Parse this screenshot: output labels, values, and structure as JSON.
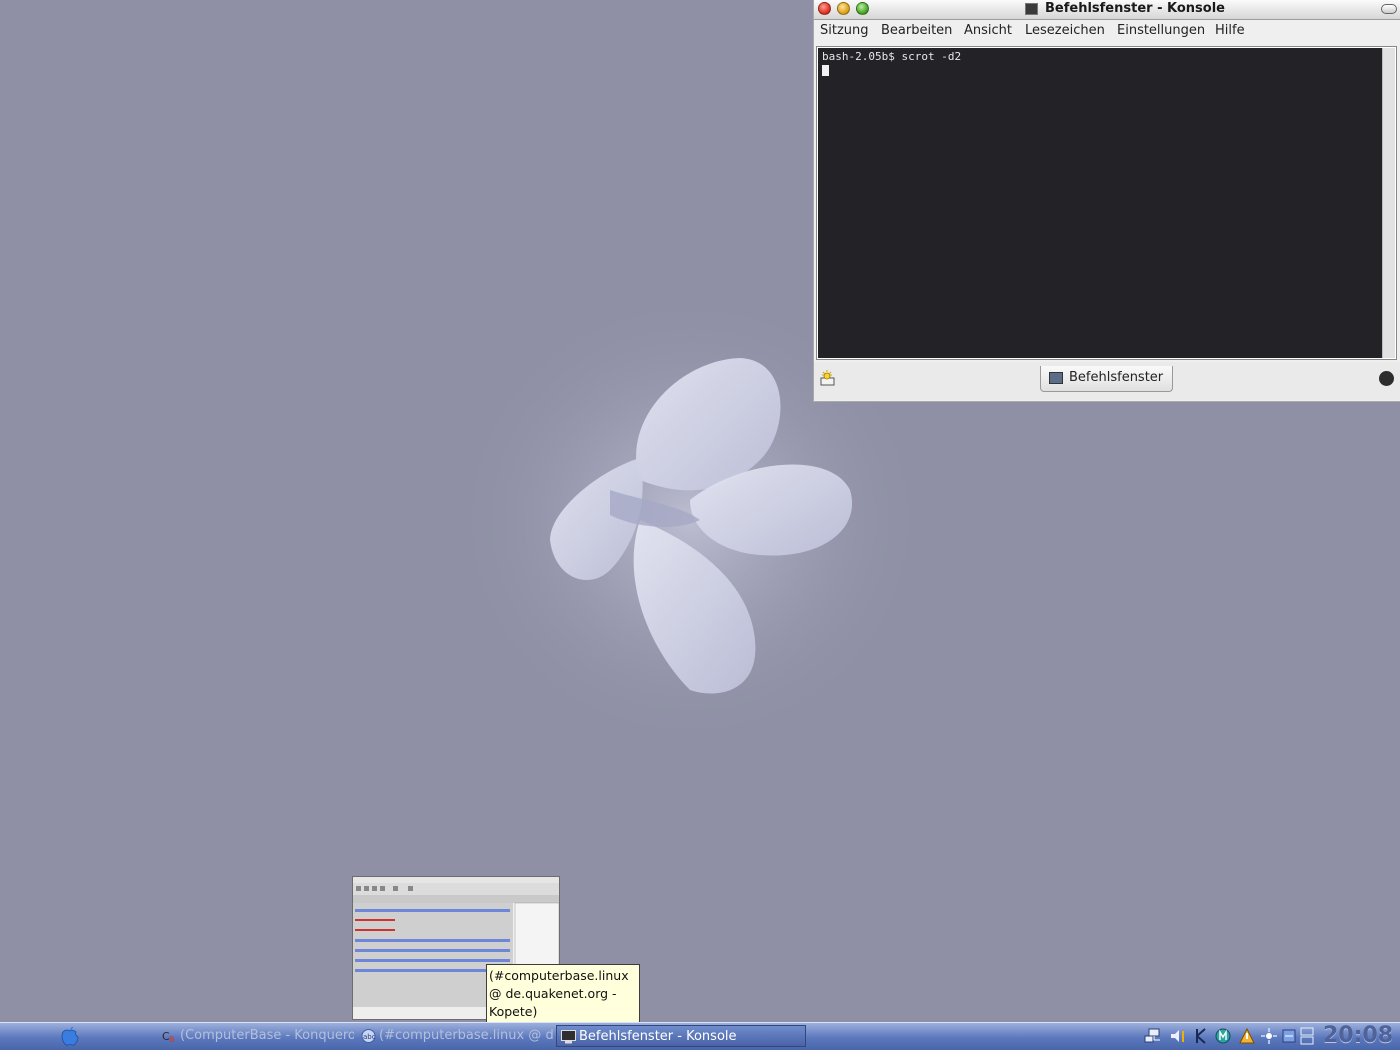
{
  "konsole": {
    "title": "Befehlsfenster - Konsole",
    "menu": [
      "Sitzung",
      "Bearbeiten",
      "Ansicht",
      "Lesezeichen",
      "Einstellungen",
      "Hilfe"
    ],
    "terminal_line": "bash-2.05b$ scrot -d2",
    "session_tab_label": "Befehlsfenster"
  },
  "tooltip": {
    "lines": [
      "(#computerbase.linux",
      "@ de.quakenet.org -",
      "Kopete)"
    ]
  },
  "taskbar": {
    "tasks": [
      {
        "label": "(ComputerBase - Konqueror",
        "icon": "konqueror-icon"
      },
      {
        "label": "(#computerbase.linux @ de.quakenet.org - Kopete)",
        "icon": "kopete-icon"
      },
      {
        "label": "Befehlsfenster - Konsole",
        "icon": "konsole-icon",
        "active": true
      }
    ],
    "clock": "20:08"
  },
  "colors": {
    "desktop": "#8f90a5",
    "terminal_bg": "#232227",
    "taskbar": "#5c78bd",
    "tooltip_bg": "#ffffdc"
  }
}
